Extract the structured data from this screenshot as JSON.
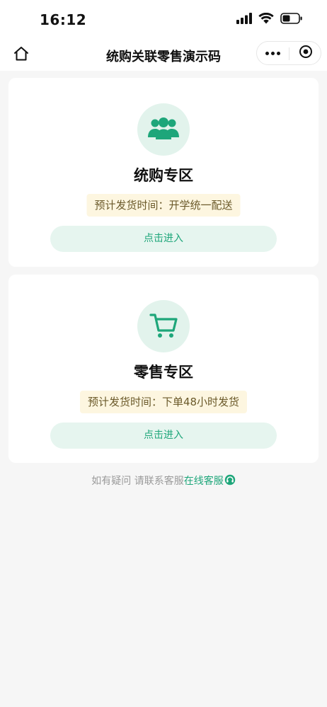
{
  "status_bar": {
    "time": "16:12"
  },
  "nav": {
    "title": "统购关联零售演示码"
  },
  "zones": [
    {
      "title": "统购专区",
      "delivery": "预计发货时间：开学统一配送",
      "button": "点击进入",
      "icon": "group-users-icon"
    },
    {
      "title": "零售专区",
      "delivery": "预计发货时间：下单48小时发货",
      "button": "点击进入",
      "icon": "shopping-cart-icon"
    }
  ],
  "footer": {
    "prompt": "如有疑问 请联系客服",
    "link": "在线客服",
    "icon": "headset-icon"
  },
  "colors": {
    "accent": "#1ea67a",
    "icon_bg": "#e2f3ec",
    "tag_bg": "#fdf6e0",
    "page_bg": "#f6f6f6"
  }
}
